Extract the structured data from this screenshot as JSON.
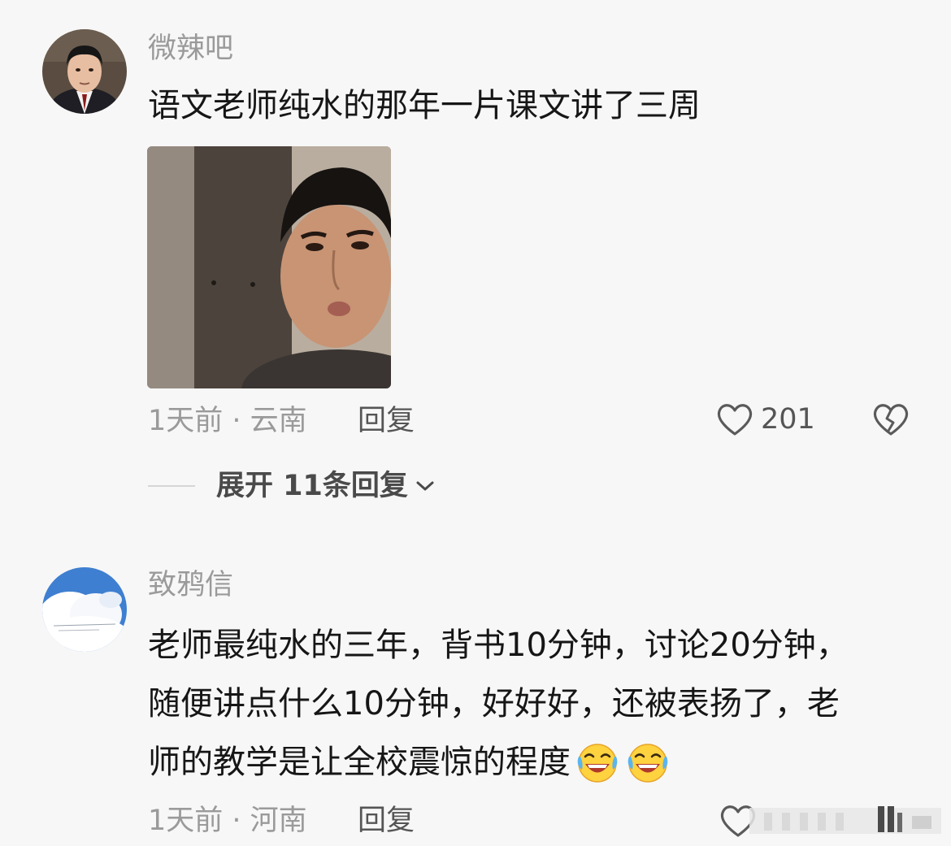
{
  "comments": [
    {
      "username": "微辣吧",
      "lines": [
        "语文老师纯水的那年一片课文讲了三周"
      ],
      "time_location": "1天前 · 云南",
      "reply_label": "回复",
      "likes": "201",
      "expand_label": "展开 11条回复"
    },
    {
      "username": "致鸦信",
      "lines": [
        "老师最纯水的三年，背书10分钟，讨论20分钟，",
        "随便讲点什么10分钟，好好好，还被表扬了，老",
        "师的教学是让全校震惊的程度"
      ],
      "time_location": "1天前 · 河南",
      "reply_label": "回复"
    }
  ],
  "icons": {
    "like": "heart-outline-icon",
    "dislike": "broken-heart-icon",
    "expand": "chevron-down-icon",
    "emoji": "tears-of-joy-emoji"
  },
  "colors": {
    "background": "#f7f7f7",
    "username": "#9a9a9a",
    "text": "#161616"
  }
}
